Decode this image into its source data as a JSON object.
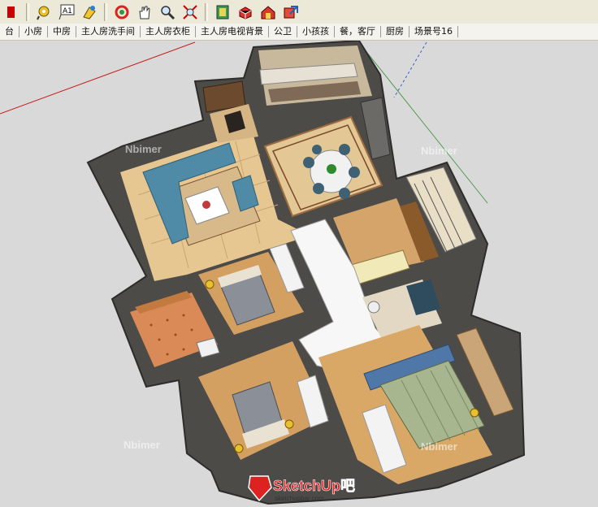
{
  "toolbar": {
    "icons": [
      "paint-bucket-icon",
      "tape-measure-icon",
      "text-icon",
      "paint-icon",
      "orbit-icon",
      "pan-icon",
      "zoom-icon",
      "zoom-extents-icon",
      "map-icon",
      "component-icon",
      "warehouse-icon",
      "export-icon"
    ],
    "text_tool_label": "A1"
  },
  "scene_tabs": [
    "台",
    "小房",
    "中房",
    "主人房洗手间",
    "主人房衣柜",
    "主人房电视背景",
    "公卫",
    "小孩孩",
    "餐，客厅",
    "厨房",
    "场景号16"
  ],
  "viewport": {
    "watermarks": [
      "Nbimer",
      "Nbimer",
      "Nbimer",
      "Nbimer"
    ],
    "logo_text": "SketchUp吧",
    "logo_url": "sketchupbar.com"
  }
}
